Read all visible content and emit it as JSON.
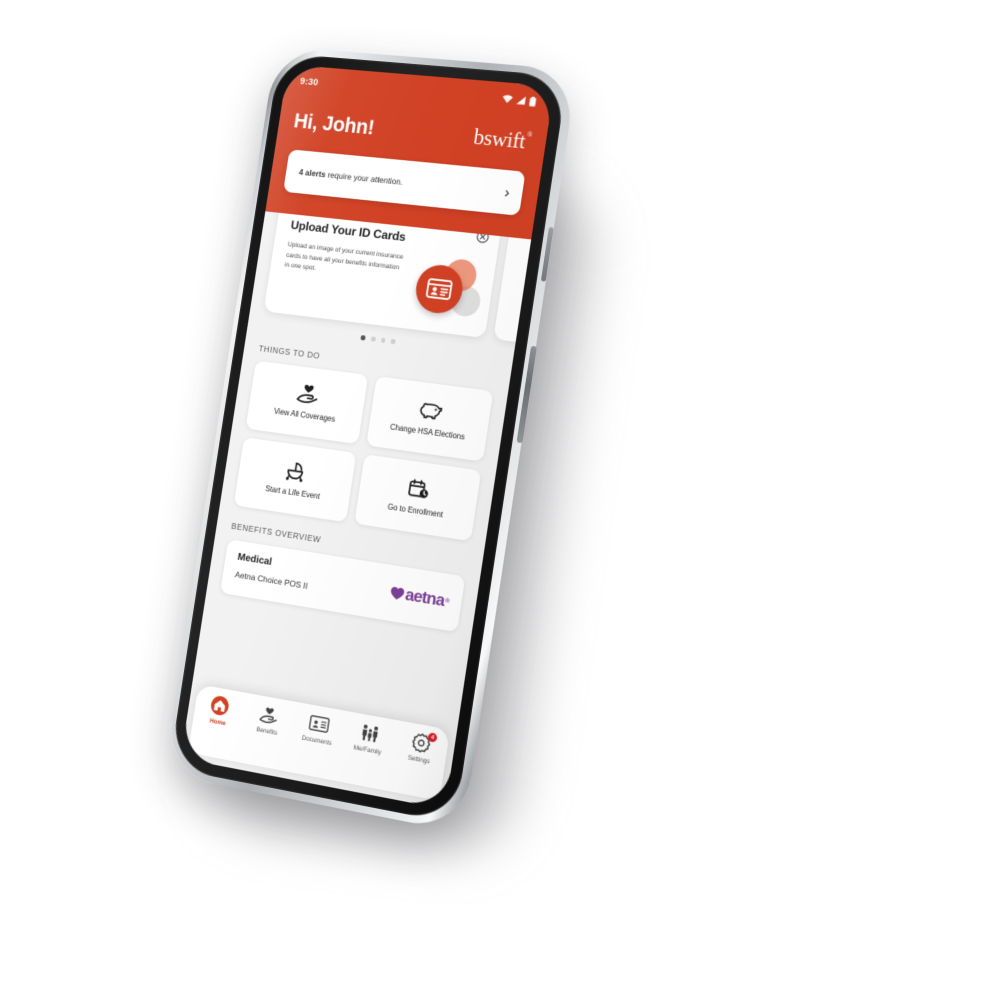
{
  "colors": {
    "brand_orange": "#d14124",
    "aetna_purple": "#7d3f98",
    "badge_red": "#e01b24",
    "screen_bg": "#f2f2f2"
  },
  "status_bar": {
    "time": "9:30",
    "icons": [
      "wifi-icon",
      "cellular-signal-icon",
      "battery-icon"
    ]
  },
  "header": {
    "greeting": "Hi, John!",
    "logo_text": "bswift",
    "logo_trademark": "®",
    "alert": {
      "count_text": "4 alerts",
      "rest_text": " require your attention.",
      "chevron": "›"
    }
  },
  "promo": {
    "title": "Upload Your ID Cards",
    "body": "Upload an image of your current insurance cards to have all your benefits information in one spot.",
    "close_icon": "close-circle-icon",
    "art_icon": "id-card-icon",
    "dots_total": 4,
    "dots_active_index": 0
  },
  "things_to_do": {
    "label": "THINGS TO DO",
    "tiles": [
      {
        "label": "View All Coverages",
        "icon": "heart-in-hand-icon"
      },
      {
        "label": "Change HSA Elections",
        "icon": "piggy-bank-icon"
      },
      {
        "label": "Start a Life Event",
        "icon": "stroller-icon"
      },
      {
        "label": "Go to Enrollment",
        "icon": "calendar-clock-icon"
      }
    ]
  },
  "benefits_overview": {
    "label": "BENEFITS OVERVIEW",
    "card": {
      "name": "Medical",
      "plan": "Aetna Choice POS II",
      "carrier_logo_text": "aetna",
      "carrier_trademark": "®"
    }
  },
  "tab_bar": {
    "tabs": [
      {
        "label": "Home",
        "icon": "home-icon",
        "active": true,
        "badge": ""
      },
      {
        "label": "Benefits",
        "icon": "heart-in-hand-icon",
        "active": false,
        "badge": ""
      },
      {
        "label": "Documents",
        "icon": "id-card-icon",
        "active": false,
        "badge": ""
      },
      {
        "label": "Me/Family",
        "icon": "family-icon",
        "active": false,
        "badge": ""
      },
      {
        "label": "Settings",
        "icon": "gear-icon",
        "active": false,
        "badge": "4"
      }
    ]
  }
}
